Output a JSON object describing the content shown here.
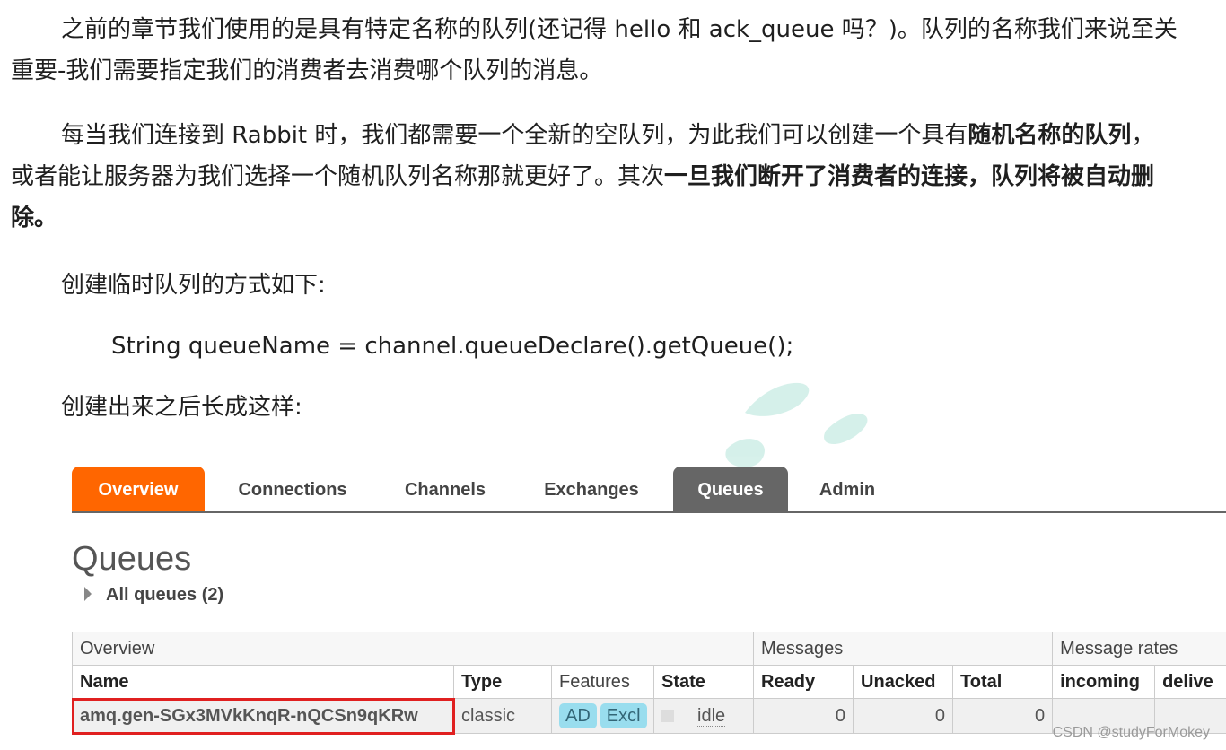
{
  "paragraphs": {
    "p1": "之前的章节我们使用的是具有特定名称的队列(还记得 hello 和 ack_queue 吗？)。队列的名称我们来说至关重要-我们需要指定我们的消费者去消费哪个队列的消息。",
    "p2_part1": "每当我们连接到 Rabbit 时，我们都需要一个全新的空队列，为此我们可以创建一个具有",
    "p2_bold1": "随机名称的队列",
    "p2_part2": "，或者能让服务器为我们选择一个随机队列名称那就更好了。其次",
    "p2_bold2": "一旦我们断开了消费者的连接，队列将被自动删除。",
    "p3": "创建临时队列的方式如下:",
    "code": "String queueName = channel.queueDeclare().getQueue();",
    "p4": "创建出来之后长成这样:"
  },
  "colors": {
    "overview_tab": "#ff6600",
    "active_tab": "#666666",
    "highlight_box": "#e02020",
    "feature_badge": "#99ddee",
    "watermark": "#1fb08e"
  },
  "rabbitmq": {
    "tabs": [
      "Overview",
      "Connections",
      "Channels",
      "Exchanges",
      "Queues",
      "Admin"
    ],
    "page_title": "Queues",
    "all_queues": "All queues (2)",
    "groups": [
      "Overview",
      "Messages",
      "Message rates"
    ],
    "columns": {
      "name": "Name",
      "type": "Type",
      "features": "Features",
      "state": "State",
      "ready": "Ready",
      "unacked": "Unacked",
      "total": "Total",
      "incoming": "incoming",
      "deliver": "delive"
    },
    "row": {
      "name": "amq.gen-SGx3MVkKnqR-nQCSn9qKRw",
      "type": "classic",
      "features": [
        "AD",
        "Excl"
      ],
      "state": "idle",
      "ready": "0",
      "unacked": "0",
      "total": "0"
    }
  },
  "credit": "CSDN @studyForMokey"
}
